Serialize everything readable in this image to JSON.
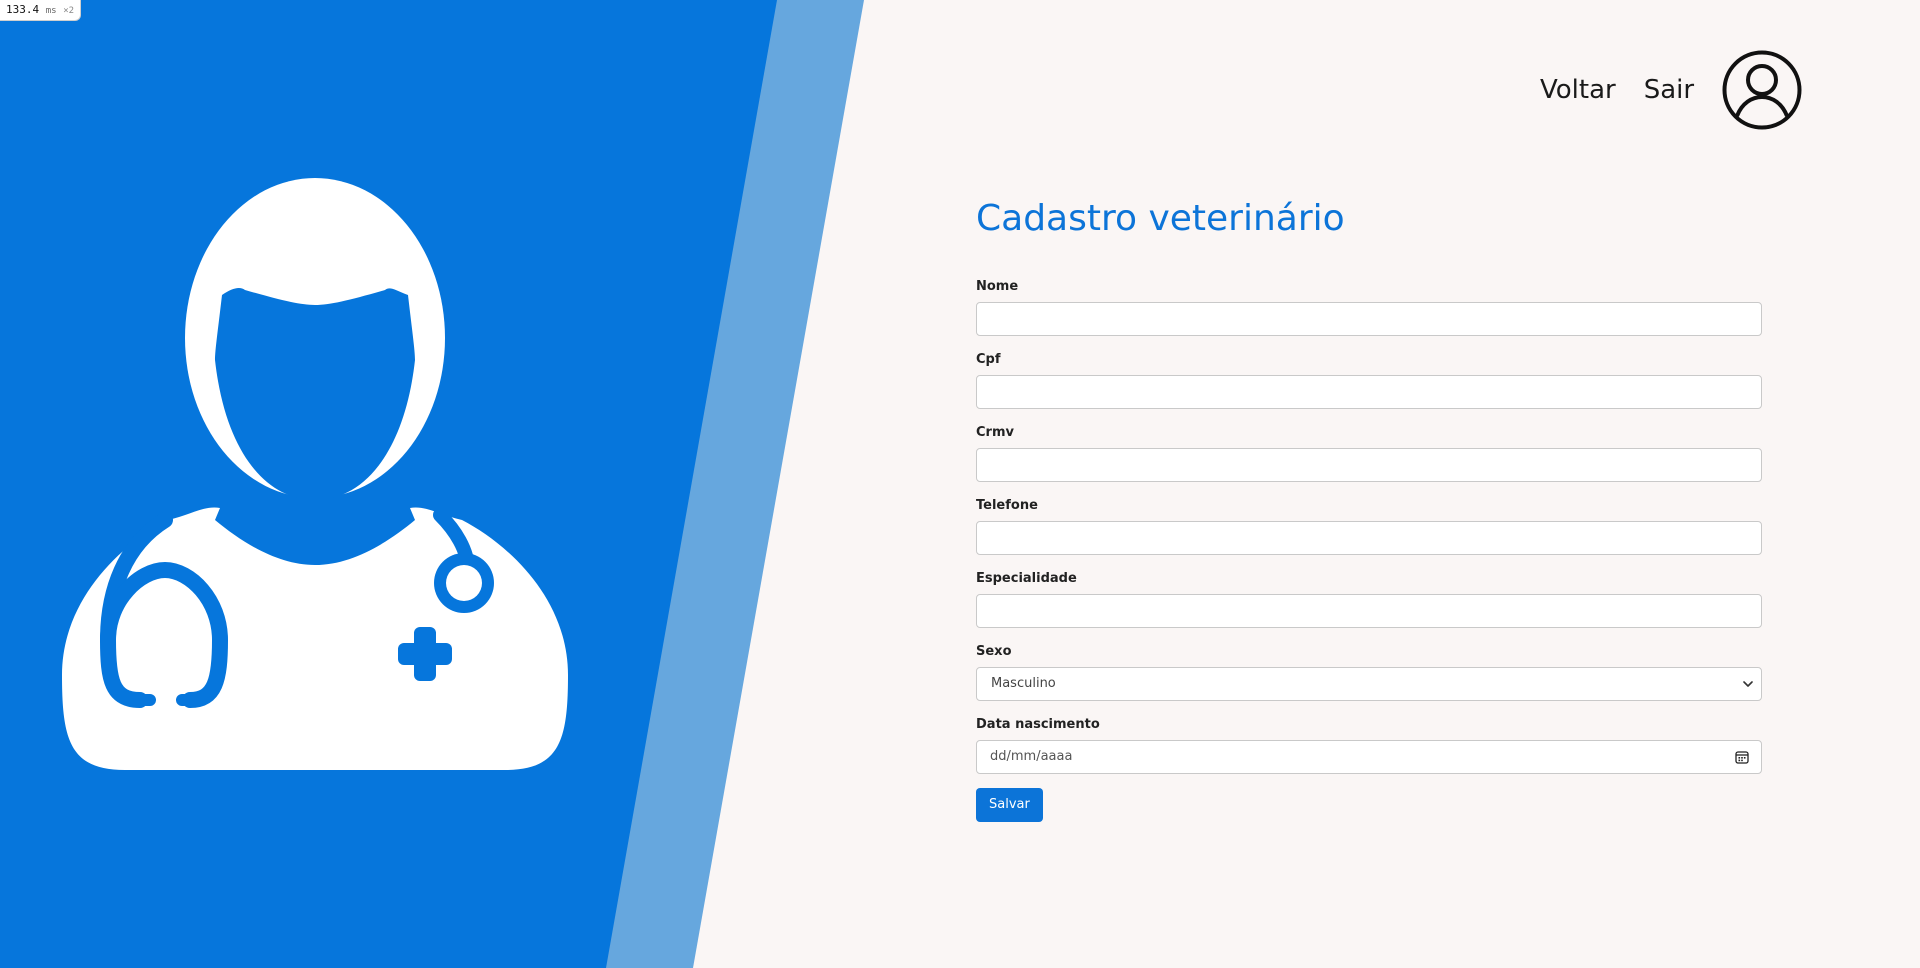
{
  "perf_badge": {
    "value": "133.4",
    "unit": "ms",
    "multiplier": "×2"
  },
  "colors": {
    "primary": "#0c74d8",
    "stripe": "#66a7de",
    "background": "#faf6f5",
    "illustration": "#ffffff"
  },
  "illustration": {
    "icon": "doctor-stethoscope-icon"
  },
  "nav": {
    "back_label": "Voltar",
    "logout_label": "Sair",
    "avatar_icon": "user-circle-icon"
  },
  "form": {
    "title": "Cadastro veterinário",
    "fields": {
      "nome": {
        "label": "Nome",
        "value": ""
      },
      "cpf": {
        "label": "Cpf",
        "value": ""
      },
      "crmv": {
        "label": "Crmv",
        "value": ""
      },
      "telefone": {
        "label": "Telefone",
        "value": ""
      },
      "especialidade": {
        "label": "Especialidade",
        "value": ""
      },
      "sexo": {
        "label": "Sexo",
        "selected": "Masculino"
      },
      "data_nascimento": {
        "label": "Data nascimento",
        "placeholder": "dd/mm/aaaa"
      }
    },
    "submit_label": "Salvar"
  }
}
